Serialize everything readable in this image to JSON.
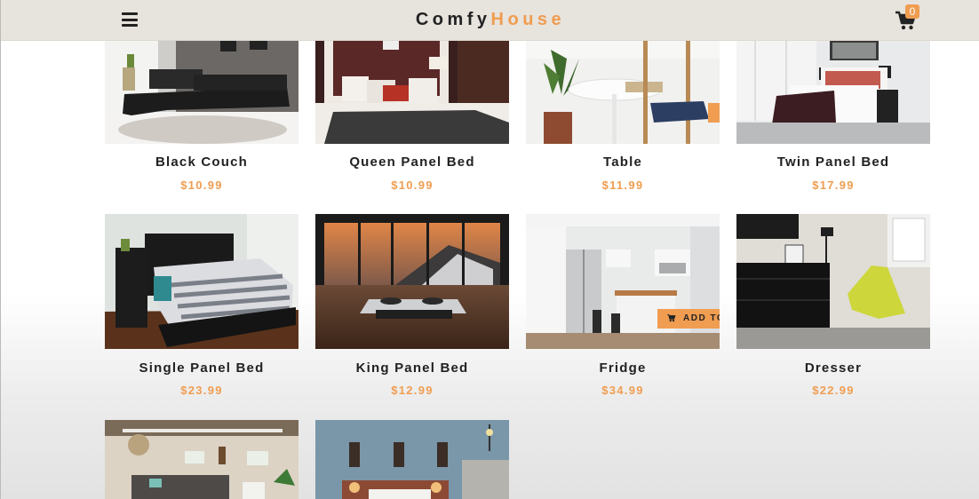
{
  "navbar": {
    "brand_primary": "Comfy",
    "brand_accent": "House",
    "cart_count": "0",
    "menu_icon": "hamburger-menu-icon",
    "cart_icon": "shopping-cart-icon"
  },
  "colors": {
    "accent": "#f09d51",
    "navbar_bg": "#e7e3dd",
    "text": "#222222"
  },
  "products": [
    {
      "name": "Black Couch",
      "price": "$10.99"
    },
    {
      "name": "Queen Panel Bed",
      "price": "$10.99"
    },
    {
      "name": "Table",
      "price": "$11.99"
    },
    {
      "name": "Twin Panel Bed",
      "price": "$17.99"
    },
    {
      "name": "Single Panel Bed",
      "price": "$23.99"
    },
    {
      "name": "King Panel Bed",
      "price": "$12.99"
    },
    {
      "name": "Fridge",
      "price": "$34.99",
      "hover_button": "ADD TO"
    },
    {
      "name": "Dresser",
      "price": "$22.99"
    },
    {
      "name": "",
      "price": ""
    },
    {
      "name": "",
      "price": ""
    }
  ]
}
